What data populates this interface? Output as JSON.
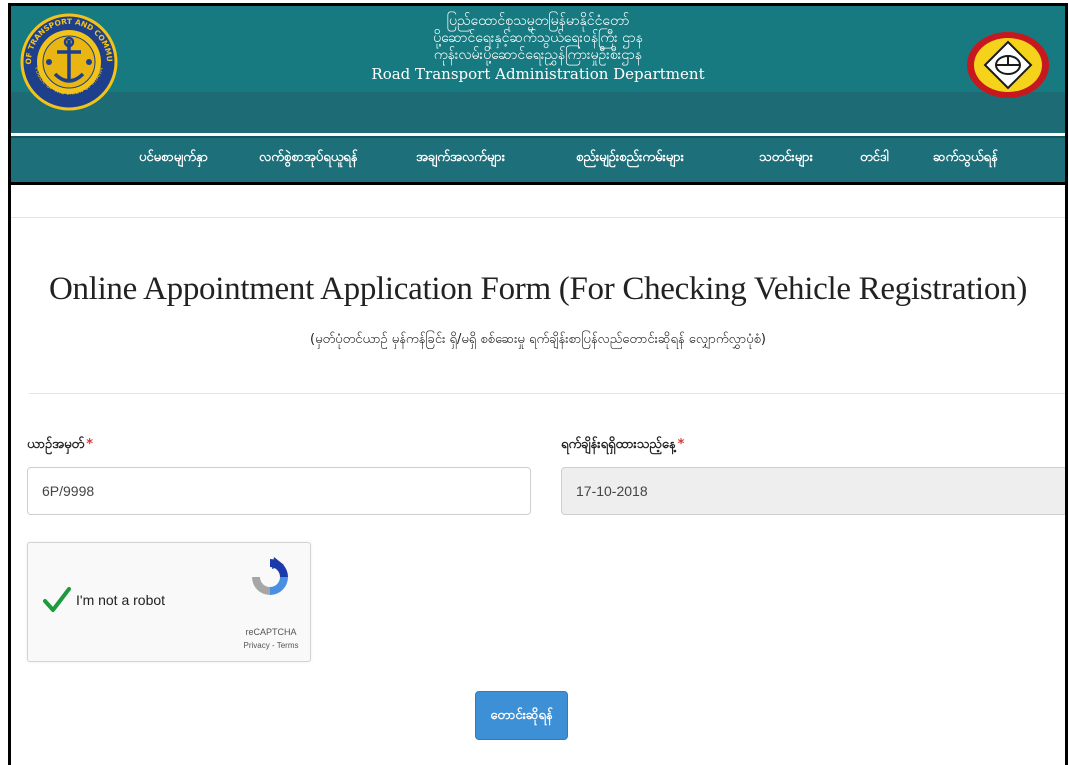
{
  "header": {
    "title_lines": [
      "ပြည်ထောင်စုသမ္မတမြန်မာနိုင်ငံတော်",
      "ပို့ဆောင်ရေးနှင့်ဆက်သွယ်ရေးဝန်ကြီး ဌာန",
      "ကုန်းလမ်းပို့ဆောင်ရေးညွှန်ကြားမှုဦးစီးဌာန"
    ],
    "title_en": "Road Transport Administration Department",
    "left_logo_text": "MINISTRY OF TRANSPORT AND COMMUNICATIONS",
    "left_logo_bottom_text": "REPUBLIC OF THE UNION OF MYANMAR"
  },
  "nav": {
    "items": [
      "ပင်မစာမျက်နှာ",
      "လက်စွဲစာအုပ်ရယူရန်",
      "အချက်အလက်များ",
      "စည်းမျဉ်းစည်းကမ်းများ",
      "သတင်းများ",
      "တင်ဒါ",
      "ဆက်သွယ်ရန်"
    ]
  },
  "form": {
    "title": "Online Appointment Application Form (For Checking Vehicle Registration)",
    "subtitle": "(မှတ်ပုံတင်ယာဉ် မှန်ကန်ခြင်း ရှိ/မရှိ စစ်ဆေးမှု ရက်ချိန်းစာပြန်လည်တောင်းဆိုရန် လျှောက်လွှာပုံစံ)",
    "vehicle_no_label": "ယာဉ်အမှတ်",
    "vehicle_no_value": "6P/9998",
    "date_label": "ရက်ချိန်းရရှိထားသည့်နေ့",
    "date_value": "17-10-2018",
    "required_mark": "*",
    "submit_label": "တောင်းဆိုရန်"
  },
  "captcha": {
    "text": "I'm not a robot",
    "brand": "reCAPTCHA",
    "links": "Privacy - Terms"
  },
  "colors": {
    "header_bg": "#167a80",
    "nav_bg": "#1d6f7a",
    "submit_bg": "#3d8fd6",
    "required": "#d9383a"
  }
}
